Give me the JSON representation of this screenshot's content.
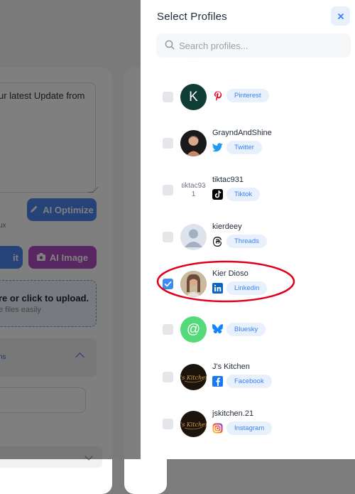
{
  "background": {
    "textarea_text": "ur latest Update from",
    "ai_optimize_label": "AI Optimize",
    "edit_label": "it",
    "ai_image_label": "AI Image",
    "max_hint": "ux",
    "upload_title": "re or click to upload.",
    "upload_subtitle": "e files easily",
    "section_label": "ns"
  },
  "drawer": {
    "title": "Select Profiles",
    "close_icon": "close-icon",
    "search": {
      "placeholder": "Search profiles...",
      "value": ""
    },
    "profiles": [
      {
        "name": "",
        "platform": "Pinterest",
        "badge": "",
        "checked": false,
        "avatar_letter": ""
      },
      {
        "name": "",
        "platform": "Pinterest",
        "badge": "Pinterest",
        "checked": false,
        "avatar_letter": "K"
      },
      {
        "name": "GrayndAndShine",
        "platform": "Twitter",
        "badge": "Twitter",
        "checked": false
      },
      {
        "name": "tiktac931",
        "platform": "Tiktok",
        "badge": "Tiktok",
        "checked": false,
        "avatar_alt": "tiktac931"
      },
      {
        "name": "kierdeey",
        "platform": "Threads",
        "badge": "Threads",
        "checked": false
      },
      {
        "name": "Kier Dioso",
        "platform": "Linkedin",
        "badge": "Linkedin",
        "checked": true
      },
      {
        "name": "",
        "platform": "Bluesky",
        "badge": "Bluesky",
        "checked": false,
        "avatar_letter": "@"
      },
      {
        "name": "J's Kitchen",
        "platform": "Facebook",
        "badge": "Facebook",
        "checked": false
      },
      {
        "name": "jskitchen.21",
        "platform": "Instagram",
        "badge": "Instagram",
        "checked": false
      }
    ]
  },
  "colors": {
    "accent": "#3b82f6",
    "badge_bg": "#e8f0fc",
    "highlight_ring": "#e0001b",
    "checked": "#3b8cf0"
  }
}
